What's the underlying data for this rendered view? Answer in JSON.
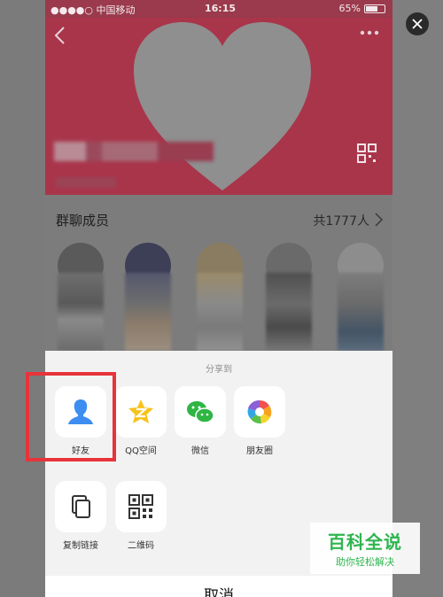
{
  "status_bar": {
    "carrier": "●●●●○ 中国移动",
    "time": "16:15",
    "battery": "65%",
    "battery_level": 0.65
  },
  "members": {
    "title": "群聊成员",
    "count": "共1777人"
  },
  "share_sheet": {
    "title": "分享到",
    "row1": [
      {
        "label": "好友",
        "icon": "friend-icon"
      },
      {
        "label": "QQ空间",
        "icon": "qzone-icon"
      },
      {
        "label": "微信",
        "icon": "wechat-icon"
      },
      {
        "label": "朋友圈",
        "icon": "moments-icon"
      }
    ],
    "row2": [
      {
        "label": "复制链接",
        "icon": "copy-link-icon"
      },
      {
        "label": "二维码",
        "icon": "qr-code-icon"
      }
    ],
    "cancel": "取消"
  },
  "watermark": {
    "title": "百科全说",
    "subtitle": "助你轻松解决"
  },
  "colors": {
    "hero": "#a9354b",
    "highlight": "#e8333a",
    "watermark": "#2eb54f"
  }
}
